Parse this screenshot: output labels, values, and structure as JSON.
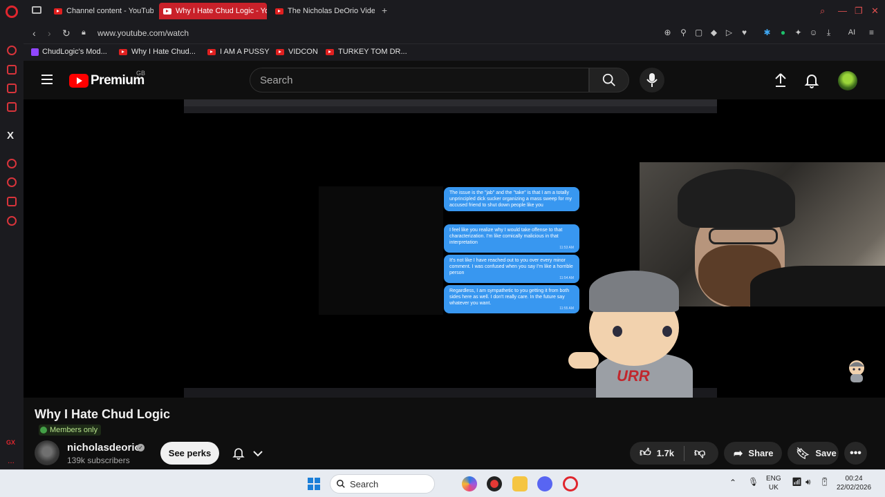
{
  "browser": {
    "tabs": [
      {
        "label": "Channel content - YouTube",
        "active": false
      },
      {
        "label": "Why I Hate Chud Logic - YouTube",
        "active": true
      },
      {
        "label": "The Nicholas DeOrio Video",
        "active": false
      }
    ],
    "new_tab": "+",
    "url": "www.youtube.com/watch",
    "ai_label": "AI",
    "bookmarks": [
      {
        "label": "ChudLogic's Mod...",
        "kind": "twitch"
      },
      {
        "label": "Why I Hate Chud...",
        "kind": "youtube"
      },
      {
        "label": "I AM A PUSSY",
        "kind": "youtube"
      },
      {
        "label": "VIDCON",
        "kind": "youtube"
      },
      {
        "label": "TURKEY TOM DR...",
        "kind": "youtube"
      }
    ],
    "sidebar": {
      "x_label": "X",
      "gx_label": "GX",
      "more_label": "..."
    }
  },
  "youtube": {
    "brand": "Premium",
    "region": "GB",
    "search_placeholder": "Search",
    "video": {
      "messages": [
        {
          "text": "The issue is the \"jab\" and the \"take\" is that I am a totally unprincipled dick sucker organizing a mass sweep for my accused friend to shut down people like you",
          "time": ""
        },
        {
          "text": "I feel like you realize why I would take offense to that characterization. I'm like comically malicious in that interpretation",
          "time": "11:53 AM"
        },
        {
          "text": "It's not like I have reached out to you over every minor comment. I was confused when you say I'm like a horrible person",
          "time": "11:54 AM"
        },
        {
          "text": "Regardless, I am sympathetic to you getting it from both sides here as well. I don't really care. In the future say whatever you want.",
          "time": "11:55 AM"
        }
      ],
      "mascot_text": "URR"
    },
    "title": "Why I Hate Chud Logic",
    "members_badge": "Members only",
    "channel": {
      "name": "nicholasdeorio",
      "verified_mark": "✓",
      "subscribers": "139k subscribers"
    },
    "perks_label": "See perks",
    "likes": "1.7k",
    "share_label": "Share",
    "save_label": "Save"
  },
  "taskbar": {
    "search_label": "Search",
    "lang_line1": "ENG",
    "lang_line2": "UK",
    "time": "00:24",
    "date": "22/02/2026"
  }
}
